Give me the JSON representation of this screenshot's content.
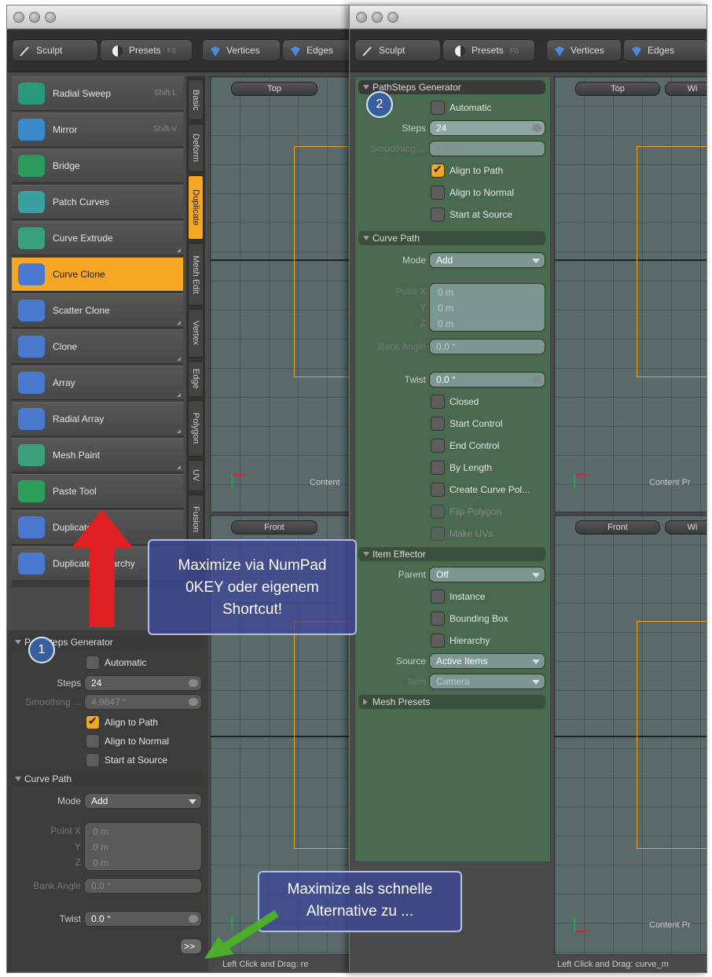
{
  "left_window": {
    "toolbar": {
      "sculpt": "Sculpt",
      "presets": "Presets",
      "presets_key": "F6",
      "vertices": "Vertices",
      "edges": "Edges"
    },
    "tools": [
      {
        "label": "Radial Sweep",
        "hotkey": "Shift-L",
        "color": "#2a9a7a"
      },
      {
        "label": "Mirror",
        "hotkey": "Shift-V",
        "color": "#3a8ac9"
      },
      {
        "label": "Bridge",
        "hotkey": "",
        "color": "#2a9a5a"
      },
      {
        "label": "Patch Curves",
        "hotkey": "",
        "color": "#3aa0a0"
      },
      {
        "label": "Curve Extrude",
        "hotkey": "",
        "color": "#3aa07a"
      },
      {
        "label": "Curve Clone",
        "hotkey": "",
        "color": "#4a7ad0"
      },
      {
        "label": "Scatter Clone",
        "hotkey": "",
        "color": "#4a7ad0"
      },
      {
        "label": "Clone",
        "hotkey": "",
        "color": "#4a7ad0"
      },
      {
        "label": "Array",
        "hotkey": "",
        "color": "#4a7ad0"
      },
      {
        "label": "Radial Array",
        "hotkey": "",
        "color": "#4a7ad0"
      },
      {
        "label": "Mesh Paint",
        "hotkey": "",
        "color": "#3aa07a"
      },
      {
        "label": "Paste Tool",
        "hotkey": "",
        "color": "#2aa05a"
      },
      {
        "label": "Duplicate",
        "hotkey": "",
        "color": "#4a7ad0"
      },
      {
        "label": "Duplicate Hierarchy",
        "hotkey": "",
        "color": "#4a7ad0"
      }
    ],
    "vtabs": [
      "Basic",
      "Deform",
      "Duplicate",
      "Mesh Edit",
      "Vertex",
      "Edge",
      "Polygon",
      "UV",
      "Fusion"
    ],
    "viewport_top": {
      "btn": "Top",
      "label": "Content"
    },
    "viewport_front": {
      "btn": "Front"
    },
    "props": {
      "section1": "PathSteps Generator",
      "automatic": "Automatic",
      "steps_label": "Steps",
      "steps_value": "24",
      "smoothing_label": "Smoothing ...",
      "smoothing_value": "4.9847 °",
      "align_path": "Align to Path",
      "align_normal": "Align to Normal",
      "start_source": "Start at Source",
      "section2": "Curve Path",
      "mode_label": "Mode",
      "mode_value": "Add",
      "pointx_label": "Point X",
      "y_label": "Y",
      "z_label": "Z",
      "px": "0 m",
      "py": "0 m",
      "pz": "0 m",
      "bank_label": "Bank Angle",
      "bank_value": "0.0 °",
      "twist_label": "Twist",
      "twist_value": "0.0 °"
    },
    "maximize_btn": ">>",
    "status": "Left Click and Drag:  re"
  },
  "right_window": {
    "toolbar": {
      "sculpt": "Sculpt",
      "presets": "Presets",
      "presets_key": "F6",
      "vertices": "Vertices",
      "edges": "Edges"
    },
    "props": {
      "section1": "PathSteps Generator",
      "automatic": "Automatic",
      "steps_label": "Steps",
      "steps_value": "24",
      "smoothing_label": "Smoothing ...",
      "smoothing_value": "4.9847 °",
      "align_path": "Align to Path",
      "align_normal": "Align to Normal",
      "start_source": "Start at Source",
      "section2": "Curve Path",
      "mode_label": "Mode",
      "mode_value": "Add",
      "pointx_label": "Point X",
      "y_label": "Y",
      "z_label": "Z",
      "px": "0 m",
      "py": "0 m",
      "pz": "0 m",
      "bank_label": "Bank Angle",
      "bank_value": "0.0 °",
      "twist_label": "Twist",
      "twist_value": "0.0 °",
      "closed": "Closed",
      "start_control": "Start Control",
      "end_control": "End Control",
      "by_length": "By Length",
      "create_curve": "Create Curve Pol...",
      "flip_polygon": "Flip Polygon",
      "make_uvs": "Make UVs",
      "section3": "Item Effector",
      "parent_label": "Parent",
      "parent_value": "Off",
      "instance": "Instance",
      "bounding_box": "Bounding Box",
      "hierarchy": "Hierarchy",
      "source_label": "Source",
      "source_value": "Active Items",
      "item_label": "Item",
      "item_value": "Camera",
      "section4": "Mesh Presets"
    },
    "viewport_top": {
      "btn": "Top",
      "btn2": "Wi",
      "label": "Content Pr"
    },
    "viewport_front": {
      "btn": "Front",
      "btn2": "Wi",
      "label": "Content Pr"
    },
    "status": "Left Click and Drag:  curve_m"
  },
  "badges": {
    "one": "1",
    "two": "2"
  },
  "callout1": {
    "line1": "Maximize via NumPad",
    "line2": "0KEY oder eigenem",
    "line3": "Shortcut!"
  },
  "callout2": {
    "line1": "Maximize als schnelle",
    "line2": "Alternative zu ..."
  },
  "colors": {
    "accent": "#f5a623",
    "callout_bg": "#3c4696",
    "arrow_red": "#e02020",
    "arrow_green": "#4caf2a"
  }
}
